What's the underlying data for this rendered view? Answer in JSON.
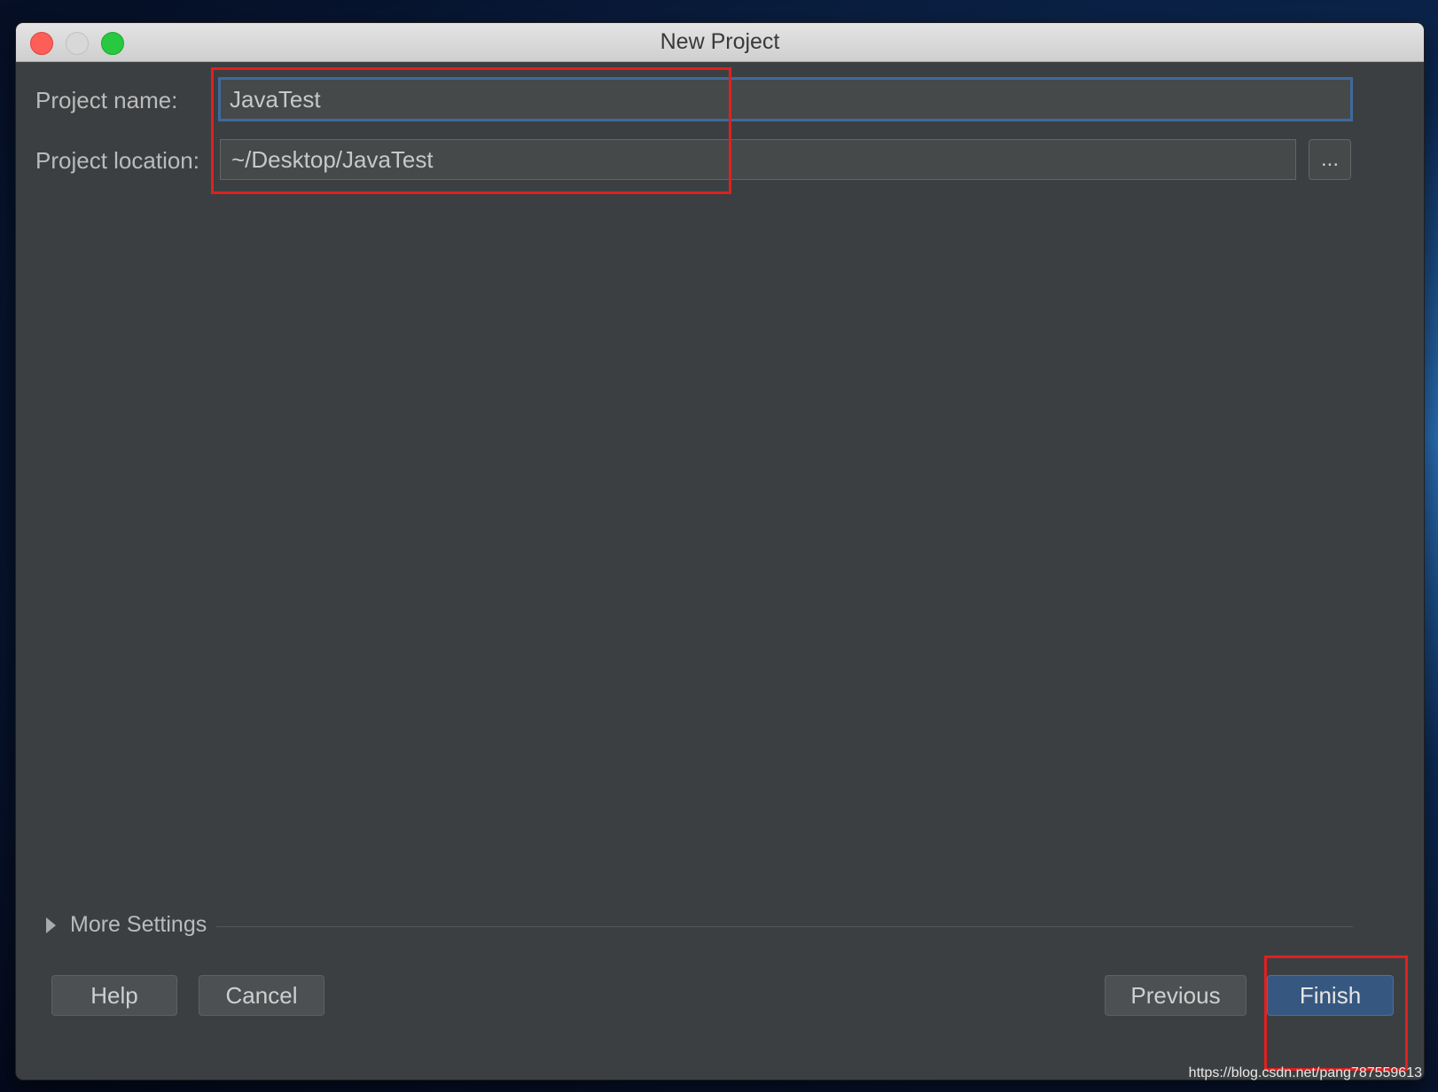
{
  "window": {
    "title": "New Project"
  },
  "form": {
    "project_name_label": "Project name:",
    "project_name_value": "JavaTest",
    "project_location_label": "Project location:",
    "project_location_value": "~/Desktop/JavaTest",
    "browse_label": "..."
  },
  "more_settings": {
    "label": "More Settings",
    "expanded": false
  },
  "buttons": {
    "help": "Help",
    "cancel": "Cancel",
    "previous": "Previous",
    "finish": "Finish"
  },
  "watermark": "https://blog.csdn.net/pang787559613",
  "colors": {
    "dialog_background": "#3c3f41",
    "focus_border": "#3d6a9c",
    "primary_button": "#365880",
    "annotation_red": "#e02020"
  }
}
